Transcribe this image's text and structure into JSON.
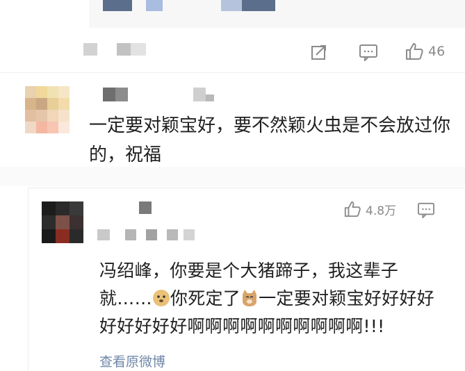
{
  "comment_top": {
    "like_count": "46"
  },
  "comment_1": {
    "text": "一定要对颖宝好，要不然颖火虫是不会放过你的，祝福"
  },
  "comment_2": {
    "like_count": "4.8万",
    "text_part1": "冯绍峰，你要是个大猪蹄子，我这辈子就……",
    "text_part2": "你死定了",
    "text_part3": "一定要对颖宝好好好好好好好好好啊啊啊啊啊啊啊啊啊啊!!!",
    "view_original": "查看原微博"
  },
  "colors": {
    "link": "#6f87a8",
    "icon_gray": "#8a8a8a"
  }
}
